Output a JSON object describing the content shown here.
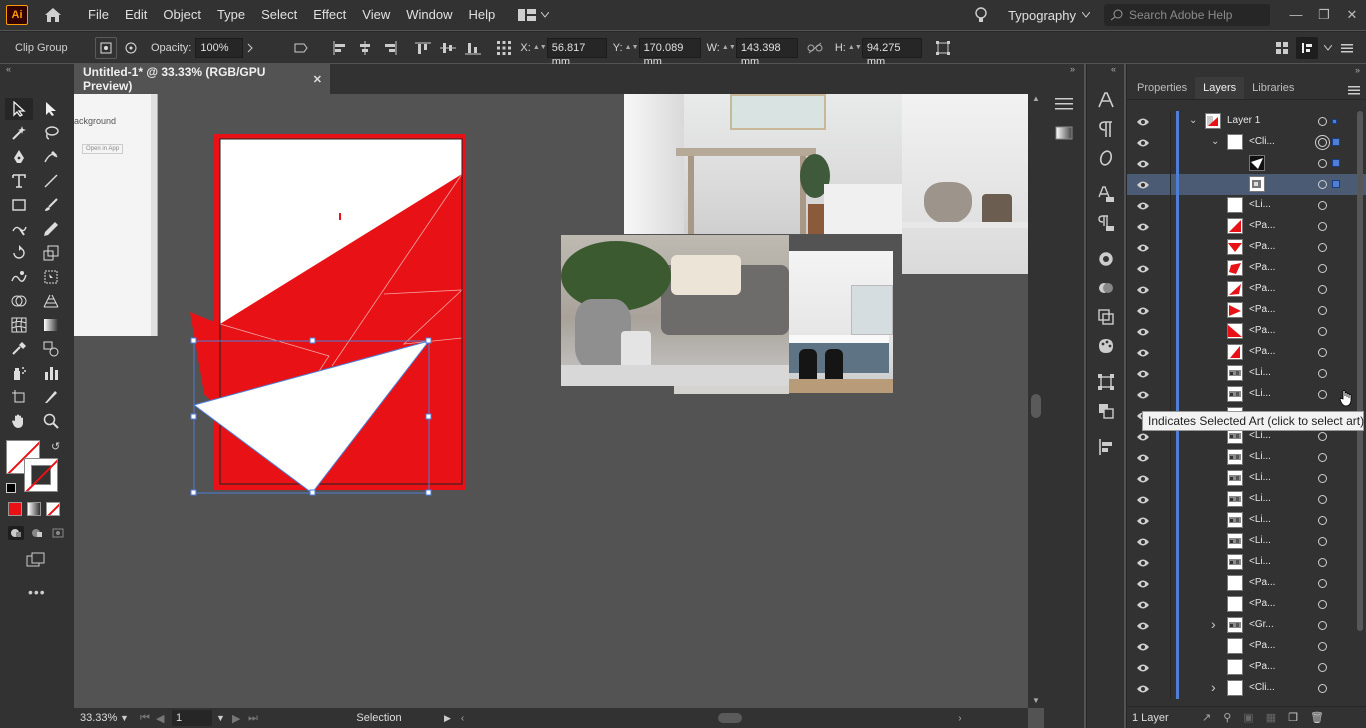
{
  "app": {
    "logo": "Ai",
    "workspace": "Typography",
    "search_placeholder": "Search Adobe Help"
  },
  "menus": [
    "File",
    "Edit",
    "Object",
    "Type",
    "Select",
    "Effect",
    "View",
    "Window",
    "Help"
  ],
  "control": {
    "selection_type": "Clip Group",
    "opacity_label": "Opacity:",
    "opacity_value": "100%",
    "x_label": "X:",
    "x_value": "56.817 mm",
    "y_label": "Y:",
    "y_value": "170.089 mm",
    "w_label": "W:",
    "w_value": "143.398 mm",
    "h_label": "H:",
    "h_value": "94.275 mm"
  },
  "document": {
    "tab_title": "Untitled-1* @ 33.33% (RGB/GPU Preview)",
    "zoom": "33.33%",
    "artboard": "1",
    "status": "Selection",
    "web_snippet_text": "ackground",
    "web_snippet_button": "Open in App"
  },
  "panel": {
    "tabs": [
      "Properties",
      "Layers",
      "Libraries"
    ],
    "active_tab": "Layers",
    "footer_count": "1 Layer",
    "tooltip": "Indicates Selected Art (click to select art)",
    "layers": [
      {
        "name": "Layer 1",
        "level": 0,
        "twisty": "down",
        "thumb": "mixed"
      },
      {
        "name": "<Cli...",
        "level": 1,
        "twisty": "down",
        "thumb": "white",
        "target": "double"
      },
      {
        "name": "",
        "level": 2,
        "thumb": "outline"
      },
      {
        "name": "",
        "level": 2,
        "thumb": "image",
        "selected": true
      },
      {
        "name": "<Li...",
        "level": 1,
        "thumb": "white"
      },
      {
        "name": "<Pa...",
        "level": 1,
        "thumb": "red1"
      },
      {
        "name": "<Pa...",
        "level": 1,
        "thumb": "red2"
      },
      {
        "name": "<Pa...",
        "level": 1,
        "thumb": "red3"
      },
      {
        "name": "<Pa...",
        "level": 1,
        "thumb": "red4"
      },
      {
        "name": "<Pa...",
        "level": 1,
        "thumb": "red5"
      },
      {
        "name": "<Pa...",
        "level": 1,
        "thumb": "red6"
      },
      {
        "name": "<Pa...",
        "level": 1,
        "thumb": "red7"
      },
      {
        "name": "<Li...",
        "level": 1,
        "thumb": "photo"
      },
      {
        "name": "<Li...",
        "level": 1,
        "thumb": "photo"
      },
      {
        "name": "",
        "level": 1,
        "thumb": "photo"
      },
      {
        "name": "<Li...",
        "level": 1,
        "thumb": "photo"
      },
      {
        "name": "<Li...",
        "level": 1,
        "thumb": "photo"
      },
      {
        "name": "<Li...",
        "level": 1,
        "thumb": "photo"
      },
      {
        "name": "<Li...",
        "level": 1,
        "thumb": "photo"
      },
      {
        "name": "<Li...",
        "level": 1,
        "thumb": "photo"
      },
      {
        "name": "<Li...",
        "level": 1,
        "thumb": "photo"
      },
      {
        "name": "<Li...",
        "level": 1,
        "thumb": "photo"
      },
      {
        "name": "<Pa...",
        "level": 1,
        "thumb": "white"
      },
      {
        "name": "<Pa...",
        "level": 1,
        "thumb": "white"
      },
      {
        "name": "<Gr...",
        "level": 1,
        "twisty": "right",
        "thumb": "photo"
      },
      {
        "name": "<Pa...",
        "level": 1,
        "thumb": "white"
      },
      {
        "name": "<Pa...",
        "level": 1,
        "thumb": "white"
      },
      {
        "name": "<Cli...",
        "level": 1,
        "twisty": "right",
        "thumb": "white"
      }
    ]
  },
  "colors": {
    "accent": "#4f7ed6",
    "red": "#e81216",
    "panel_bg": "#323232",
    "canvas_bg": "#535353"
  }
}
